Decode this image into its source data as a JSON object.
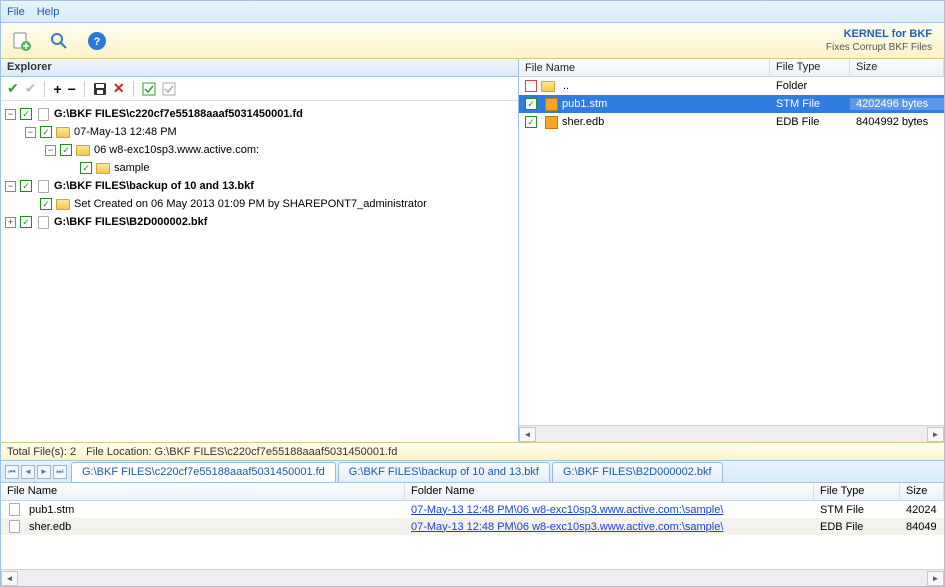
{
  "menu": {
    "file": "File",
    "help": "Help"
  },
  "brand": {
    "name": "KERNEL for BKF",
    "tag": "Fixes Corrupt BKF Files"
  },
  "explorer": {
    "title": "Explorer",
    "nodes": {
      "n1": "G:\\BKF FILES\\c220cf7e55188aaaf5031450001.fd",
      "n1a": "07-May-13 12:48 PM",
      "n1b": "06 w8-exc10sp3.www.active.com:",
      "n1c": "sample",
      "n2": "G:\\BKF FILES\\backup of 10 and 13.bkf",
      "n2a": "Set Created on 06 May 2013 01:09 PM by SHAREPONT7_administrator",
      "n3": "G:\\BKF FILES\\B2D000002.bkf"
    }
  },
  "filelist": {
    "headers": {
      "name": "File Name",
      "type": "File Type",
      "size": "Size"
    },
    "rows": [
      {
        "name": "..",
        "type": "Folder",
        "size": "",
        "up": true
      },
      {
        "name": "pub1.stm",
        "type": "STM File",
        "size": "4202496 bytes",
        "sel": true
      },
      {
        "name": "sher.edb",
        "type": "EDB File",
        "size": "8404992 bytes"
      }
    ]
  },
  "status": {
    "total": "Total File(s): 2",
    "loc": "File Location: G:\\BKF FILES\\c220cf7e55188aaaf5031450001.fd"
  },
  "tabs": [
    "G:\\BKF FILES\\c220cf7e55188aaaf5031450001.fd",
    "G:\\BKF FILES\\backup of 10 and 13.bkf",
    "G:\\BKF FILES\\B2D000002.bkf"
  ],
  "bottom": {
    "headers": {
      "fn": "File Name",
      "fld": "Folder Name",
      "ft": "File Type",
      "sz": "Size"
    },
    "rows": [
      {
        "fn": "pub1.stm",
        "fld": "07-May-13 12:48 PM\\06 w8-exc10sp3.www.active.com:\\sample\\",
        "ft": "STM File",
        "sz": "42024"
      },
      {
        "fn": "sher.edb",
        "fld": "07-May-13 12:48 PM\\06 w8-exc10sp3.www.active.com:\\sample\\",
        "ft": "EDB File",
        "sz": "84049"
      }
    ]
  }
}
